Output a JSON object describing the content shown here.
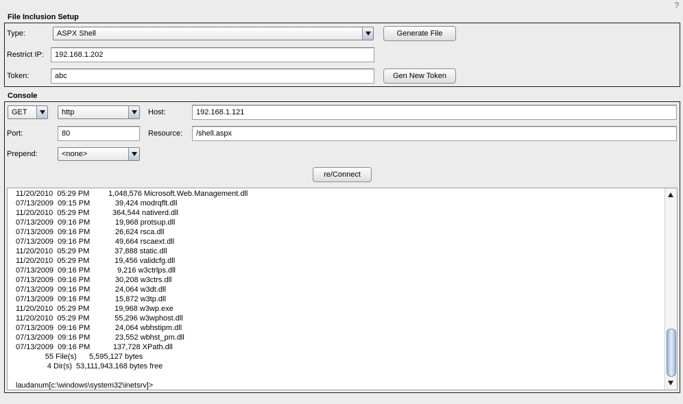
{
  "help": {
    "label": "?"
  },
  "file_inclusion": {
    "title": "File Inclusion Setup",
    "type_label": "Type:",
    "type_value": "ASPX Shell",
    "generate_button": "Generate File",
    "restrict_ip_label": "Restrict IP:",
    "restrict_ip_value": "192.168.1.202",
    "token_label": "Token:",
    "token_value": "abc",
    "gen_token_button": "Gen New Token"
  },
  "console": {
    "title": "Console",
    "method_value": "GET",
    "protocol_value": "http",
    "host_label": "Host:",
    "host_value": "192.168.1.121",
    "port_label": "Port:",
    "port_value": "80",
    "resource_label": "Resource:",
    "resource_value": "/shell.aspx",
    "prepend_label": "Prepend:",
    "prepend_value": "<none>",
    "connect_button": "re/Connect",
    "output": "11/20/2010  05:29 PM         1,048,576 Microsoft.Web.Management.dll\n07/13/2009  09:15 PM            39,424 modrqflt.dll\n11/20/2010  05:29 PM           364,544 nativerd.dll\n07/13/2009  09:16 PM            19,968 protsup.dll\n07/13/2009  09:16 PM            26,624 rsca.dll\n07/13/2009  09:16 PM            49,664 rscaext.dll\n11/20/2010  05:29 PM            37,888 static.dll\n11/20/2010  05:29 PM            19,456 validcfg.dll\n07/13/2009  09:16 PM             9,216 w3ctrlps.dll\n07/13/2009  09:16 PM            30,208 w3ctrs.dll\n07/13/2009  09:16 PM            24,064 w3dt.dll\n07/13/2009  09:16 PM            15,872 w3tp.dll\n11/20/2010  05:29 PM            19,968 w3wp.exe\n11/20/2010  05:29 PM            55,296 w3wphost.dll\n07/13/2009  09:16 PM            24,064 wbhstipm.dll\n07/13/2009  09:16 PM            23,552 wbhst_pm.dll\n07/13/2009  09:16 PM           137,728 XPath.dll\n              55 File(s)      5,595,127 bytes\n               4 Dir(s)  53,111,943,168 bytes free\n\nlaudanum[c:\\windows\\system32\\inetsrv]>"
  }
}
